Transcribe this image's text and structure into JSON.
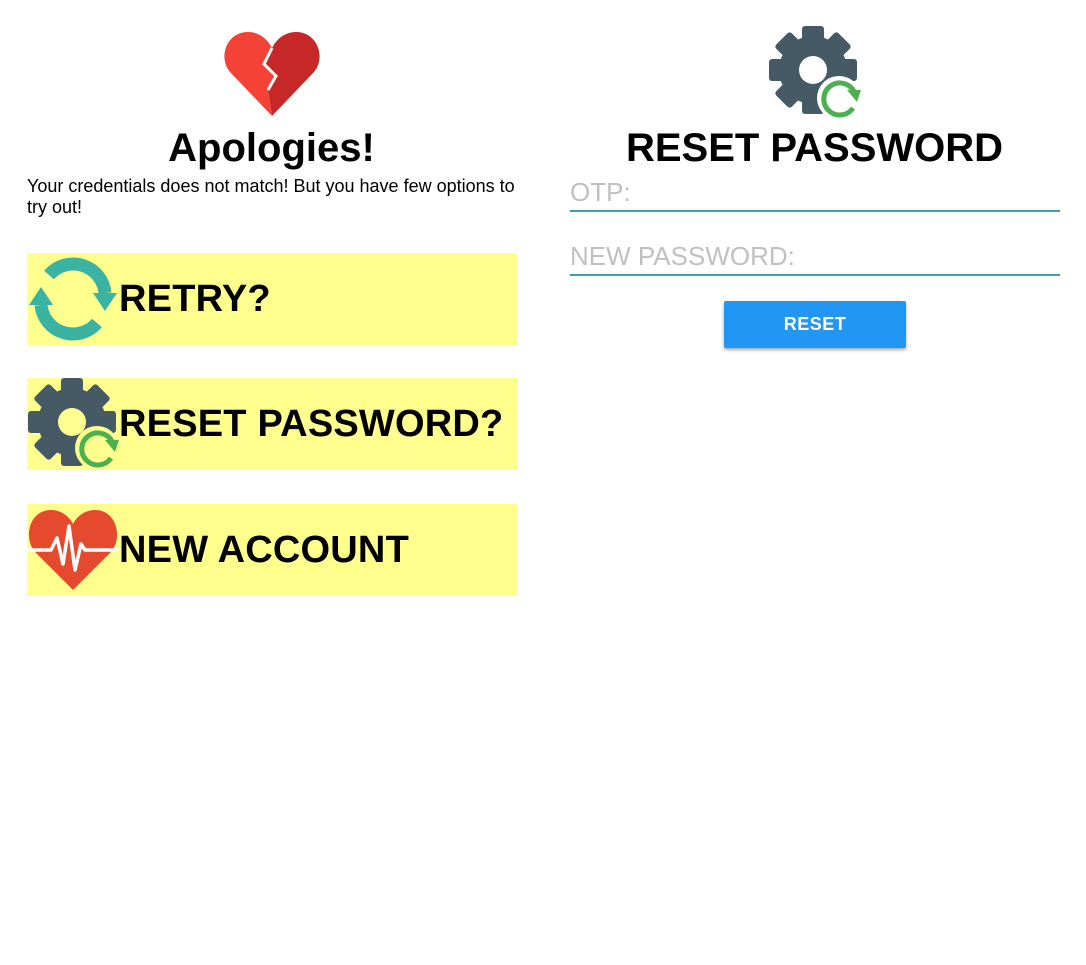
{
  "left_panel": {
    "icon": "broken-heart-icon",
    "title": "Apologies!",
    "message": "Your credentials does not match! But you have few options to try out!",
    "options": [
      {
        "label": "RETRY?",
        "icon": "refresh-arrows-icon"
      },
      {
        "label": "RESET PASSWORD?",
        "icon": "gear-refresh-icon"
      },
      {
        "label": "NEW ACCOUNT",
        "icon": "heart-pulse-icon"
      }
    ]
  },
  "right_panel": {
    "icon": "gear-refresh-icon",
    "title": "RESET PASSWORD",
    "otp_field": {
      "placeholder": "OTP:",
      "value": ""
    },
    "new_password_field": {
      "placeholder": "NEW PASSWORD:",
      "value": ""
    },
    "reset_button_label": "RESET"
  },
  "colors": {
    "option_background": "#ffff8d",
    "button_blue": "#2196f3",
    "input_underline": "#3e9bb0",
    "gear": "#455a64",
    "refresh_green": "#4caf50",
    "retry_teal": "#3bb3a3",
    "heart_red": "#e64a2e"
  }
}
